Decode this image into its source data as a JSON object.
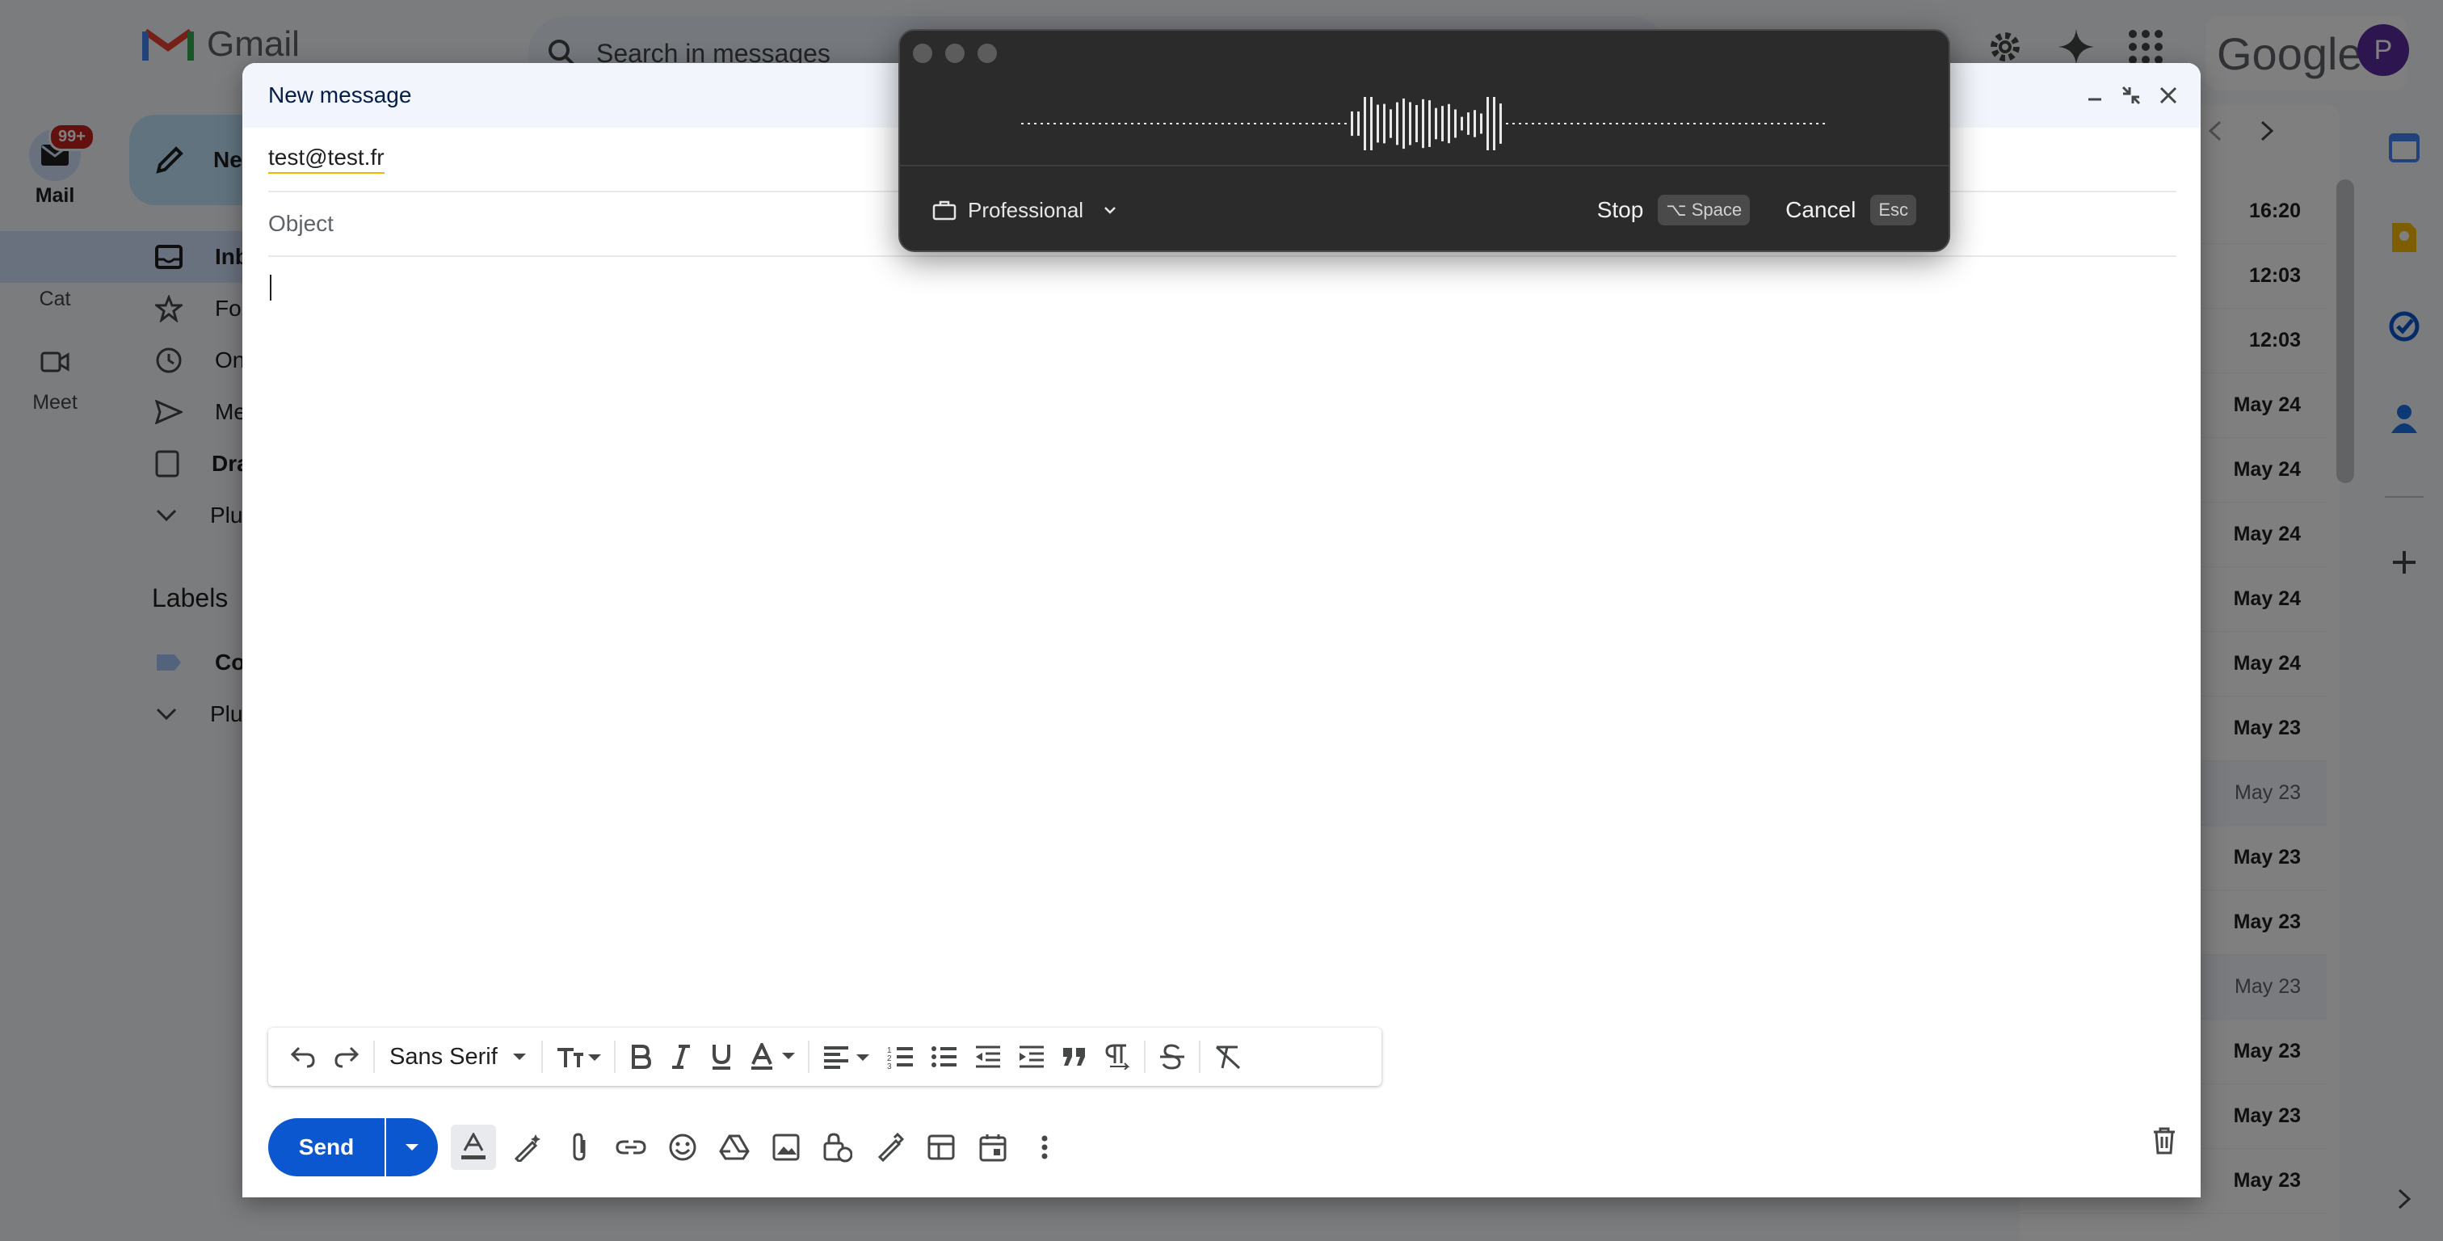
{
  "gmail": {
    "app_name": "Gmail",
    "search_placeholder": "Search in messages",
    "google_word": "Google",
    "avatar_initial": "P",
    "rail": [
      {
        "label": "Mail",
        "badge": "99+"
      },
      {
        "label": "Cat"
      },
      {
        "label": "Meet"
      }
    ],
    "compose_label": "Ne",
    "nav": [
      {
        "label": "Inb"
      },
      {
        "label": "Fol"
      },
      {
        "label": "On"
      },
      {
        "label": "Me"
      },
      {
        "label": "Dra"
      },
      {
        "label": "Plu"
      }
    ],
    "labels_title": "Labels",
    "labels": [
      {
        "label": "Co"
      },
      {
        "label": "Plu"
      }
    ],
    "mail_dates": [
      "16:20",
      "12:03",
      "12:03",
      "May 24",
      "May 24",
      "May 24",
      "May 24",
      "May 24",
      "May 23",
      "May 23",
      "May 23",
      "May 23",
      "May 23",
      "May 23",
      "May 23",
      "May 23"
    ]
  },
  "compose": {
    "title": "New message",
    "to_value": "test@test.fr",
    "subject_placeholder": "Object",
    "font_name": "Sans Serif",
    "send_label": "Send"
  },
  "dictation": {
    "mode_label": "Professional",
    "stop_label": "Stop",
    "stop_shortcut": "⌥ Space",
    "cancel_label": "Cancel",
    "cancel_shortcut": "Esc"
  }
}
